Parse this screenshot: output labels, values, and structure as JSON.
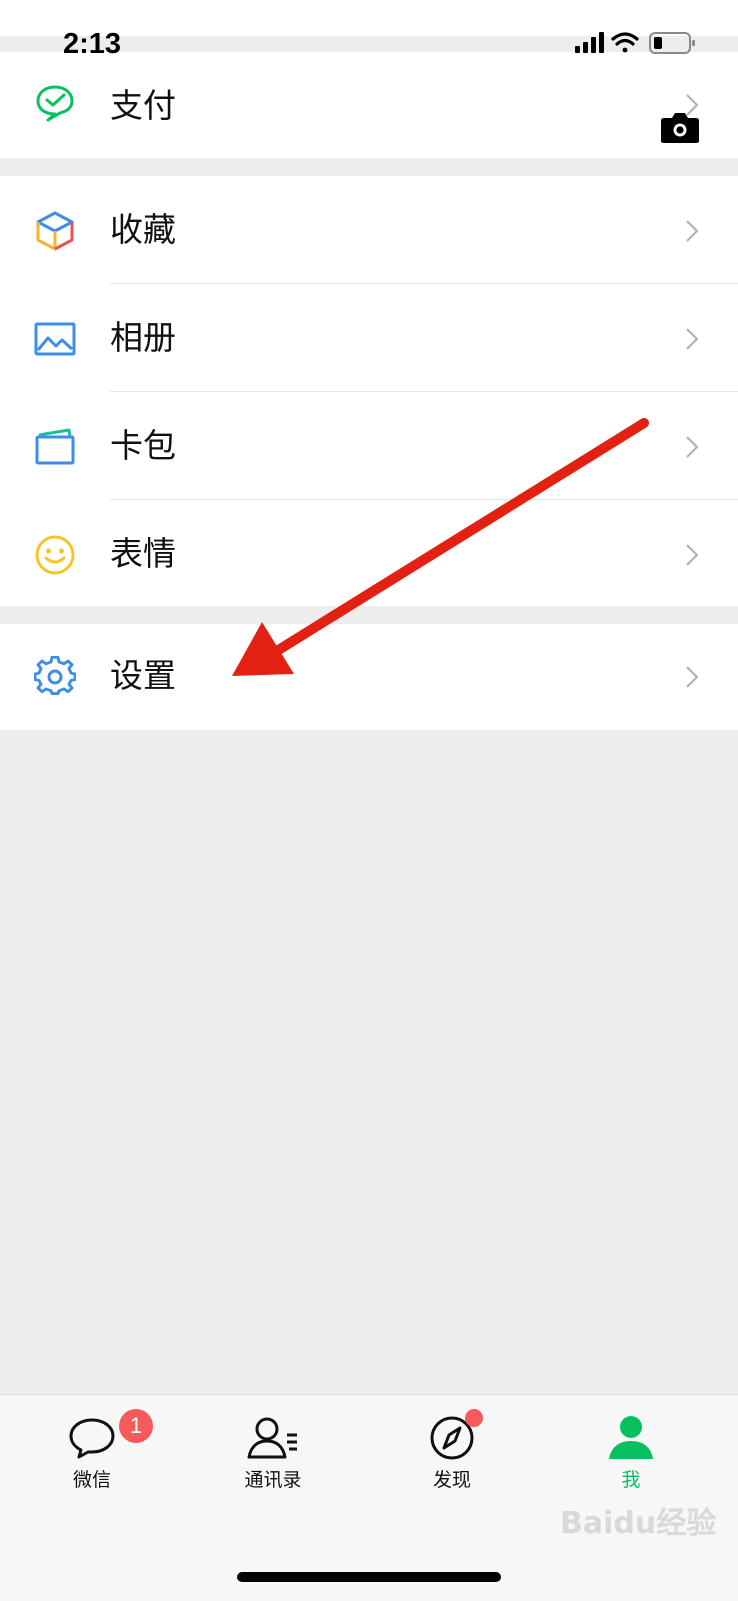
{
  "status_bar": {
    "time": "2:13"
  },
  "menu": {
    "pay": {
      "label": "支付"
    },
    "favorites": {
      "label": "收藏"
    },
    "album": {
      "label": "相册"
    },
    "cards": {
      "label": "卡包"
    },
    "stickers": {
      "label": "表情"
    },
    "settings": {
      "label": "设置"
    }
  },
  "tabbar": {
    "chats": {
      "label": "微信",
      "badge": "1"
    },
    "contacts": {
      "label": "通讯录"
    },
    "discover": {
      "label": "发现"
    },
    "me": {
      "label": "我"
    }
  },
  "watermark": "Baidu经验",
  "icons": {
    "pay": "pay-check-icon",
    "favorites": "cube-icon",
    "album": "picture-icon",
    "cards": "card-wallet-icon",
    "stickers": "smiley-icon",
    "settings": "gear-icon",
    "camera": "camera-icon",
    "chats": "chat-bubble-icon",
    "contacts": "contacts-icon",
    "discover": "compass-icon",
    "me": "person-icon"
  },
  "colors": {
    "accent_green": "#07c160",
    "badge_red": "#f65a5b",
    "arrow_red": "#e32112",
    "background": "#ededed"
  }
}
